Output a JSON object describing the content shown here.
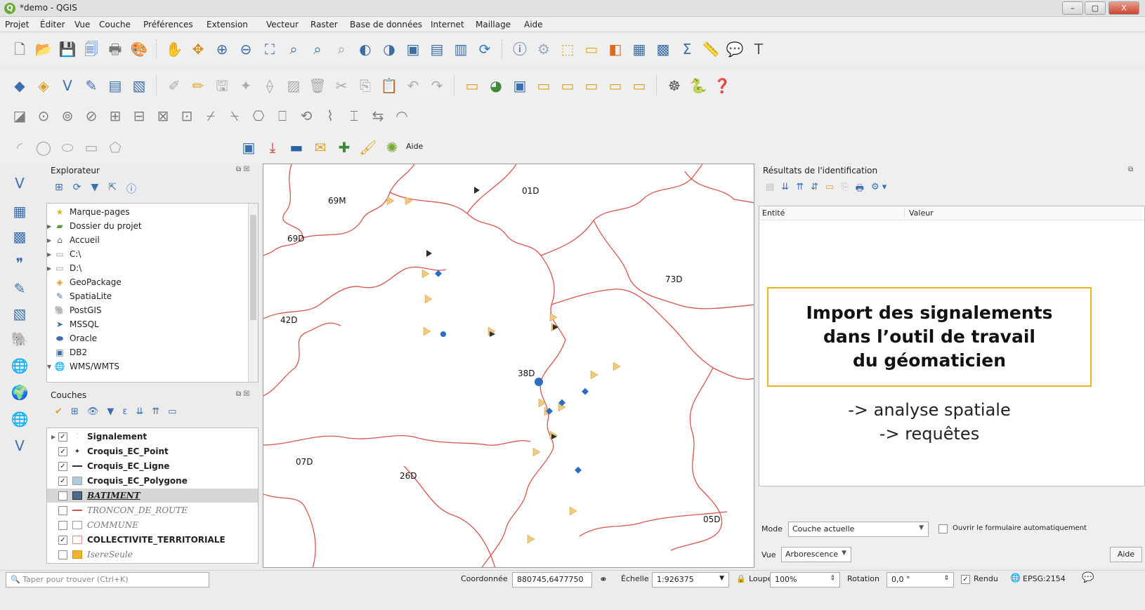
{
  "window": {
    "title": "*demo - QGIS",
    "minimize": "–",
    "maximize": "▢",
    "close": "X"
  },
  "menu": [
    "Projet",
    "Éditer",
    "Vue",
    "Couche",
    "Préférences",
    "Extension",
    "Vecteur",
    "Raster",
    "Base de données",
    "Internet",
    "Maillage",
    "Aide"
  ],
  "toolbar_help_label": "Aide",
  "explorer": {
    "title": "Explorateur",
    "items": [
      {
        "label": "Marque-pages",
        "icon": "star-icon",
        "expand": false
      },
      {
        "label": "Dossier du projet",
        "icon": "project-folder-icon",
        "expand": true
      },
      {
        "label": "Accueil",
        "icon": "home-icon",
        "expand": true
      },
      {
        "label": "C:\\",
        "icon": "folder-icon",
        "expand": true
      },
      {
        "label": "D:\\",
        "icon": "folder-icon",
        "expand": true
      },
      {
        "label": "GeoPackage",
        "icon": "geopackage-icon",
        "expand": false
      },
      {
        "label": "SpatiaLite",
        "icon": "spatialite-icon",
        "expand": false
      },
      {
        "label": "PostGIS",
        "icon": "postgis-icon",
        "expand": false
      },
      {
        "label": "MSSQL",
        "icon": "mssql-icon",
        "expand": false
      },
      {
        "label": "Oracle",
        "icon": "oracle-icon",
        "expand": false
      },
      {
        "label": "DB2",
        "icon": "db2-icon",
        "expand": false
      },
      {
        "label": "WMS/WMTS",
        "icon": "wms-icon",
        "expand": true
      }
    ]
  },
  "layers": {
    "title": "Couches",
    "items": [
      {
        "label": "Signalement",
        "checked": true,
        "bold": true,
        "italic": false,
        "swatch": "points"
      },
      {
        "label": "Croquis_EC_Point",
        "checked": true,
        "bold": true,
        "italic": false,
        "swatch": "dot"
      },
      {
        "label": "Croquis_EC_Ligne",
        "checked": true,
        "bold": true,
        "italic": false,
        "swatch": "line-dark"
      },
      {
        "label": "Croquis_EC_Polygone",
        "checked": true,
        "bold": true,
        "italic": false,
        "swatch": "poly-blue"
      },
      {
        "label": "BATIMENT",
        "checked": false,
        "bold": true,
        "italic": true,
        "swatch": "poly-slate",
        "selected": true
      },
      {
        "label": "TRONCON_DE_ROUTE",
        "checked": false,
        "bold": false,
        "italic": true,
        "swatch": "line-red"
      },
      {
        "label": "COMMUNE",
        "checked": false,
        "bold": false,
        "italic": true,
        "swatch": "poly-empty"
      },
      {
        "label": "COLLECTIVITE_TERRITORIALE",
        "checked": true,
        "bold": true,
        "italic": false,
        "swatch": "poly-pink"
      },
      {
        "label": "IsereSeule",
        "checked": false,
        "bold": false,
        "italic": true,
        "swatch": "poly-orange"
      }
    ]
  },
  "map": {
    "labels": [
      "69M",
      "01D",
      "69D",
      "73D",
      "42D",
      "38D",
      "07D",
      "26D",
      "05D"
    ]
  },
  "identify": {
    "title": "Résultats de l'identification",
    "col_entity": "Entité",
    "col_value": "Valeur",
    "mode_label": "Mode",
    "mode_value": "Couche actuelle",
    "auto_form_label": "Ouvrir le formulaire automatiquement",
    "view_label": "Vue",
    "view_value": "Arborescence",
    "help_button": "Aide"
  },
  "callout": {
    "line1": "Import des signalements",
    "line2": "dans l’outil de travail",
    "line3": "du géomaticien",
    "bullet1": "-> analyse spatiale",
    "bullet2": "-> requêtes"
  },
  "statusbar": {
    "search_placeholder": "Taper pour trouver (Ctrl+K)",
    "coord_label": "Coordonnée",
    "coord_value": "880745,6477750",
    "scale_label": "Échelle",
    "scale_value": "1:926375",
    "magnifier_label": "Loupe",
    "magnifier_value": "100%",
    "rotation_label": "Rotation",
    "rotation_value": "0,0 °",
    "render_label": "Rendu",
    "crs": "EPSG:2154"
  }
}
